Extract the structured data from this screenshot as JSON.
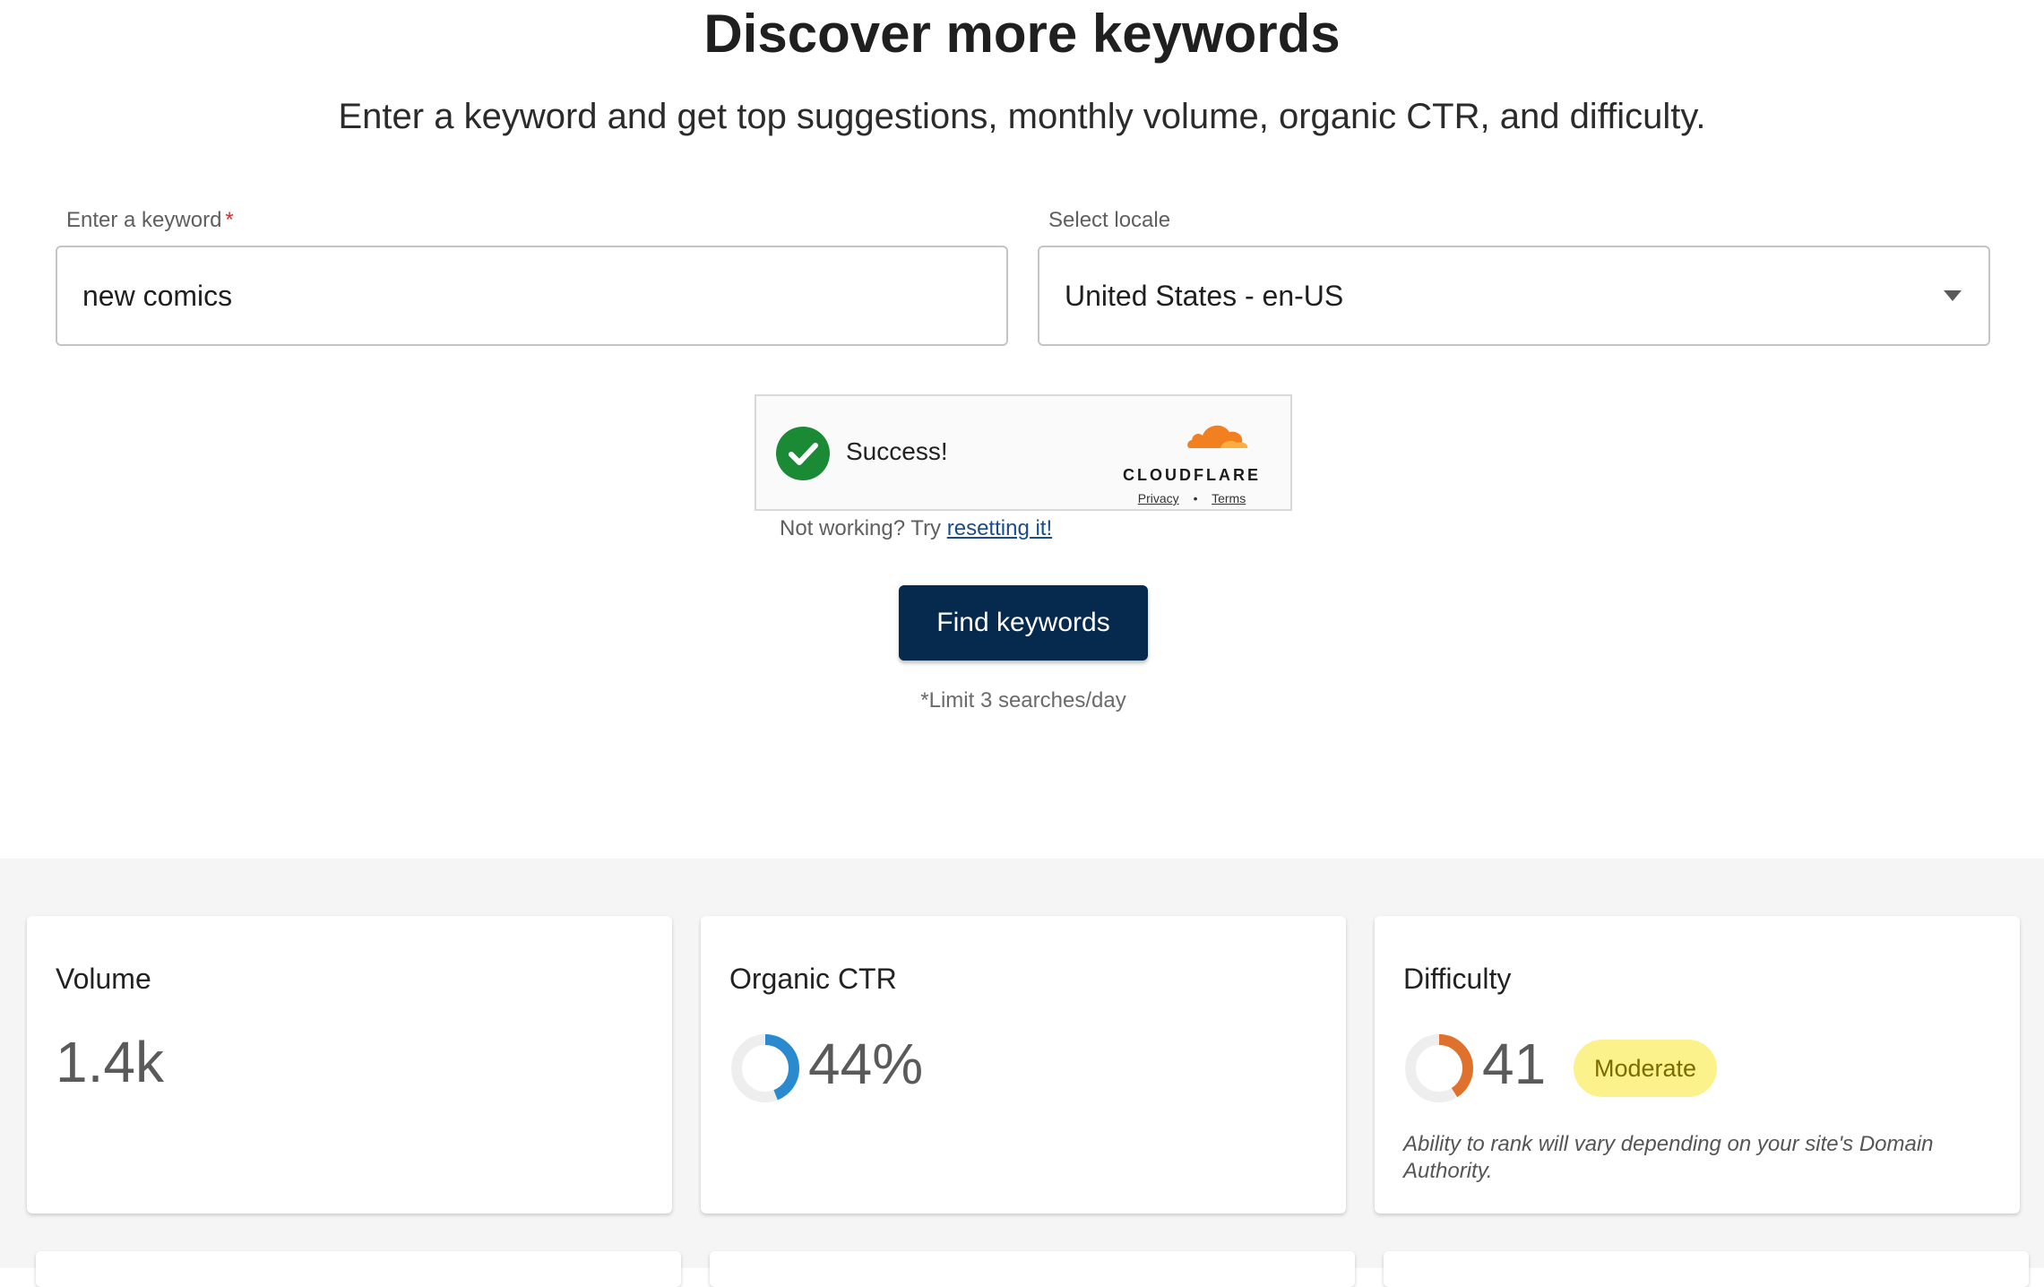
{
  "header": {
    "title": "Discover more keywords",
    "subtitle": "Enter a keyword and get top suggestions, monthly volume, organic CTR, and difficulty."
  },
  "form": {
    "keyword_label": "Enter a keyword",
    "keyword_required_mark": "*",
    "keyword_value": "new comics",
    "locale_label": "Select locale",
    "locale_value": "United States - en-US"
  },
  "captcha": {
    "status": "Success!",
    "brand": "CLOUDFLARE",
    "privacy": "Privacy",
    "separator": "•",
    "terms": "Terms",
    "not_working": "Not working? Try",
    "reset_link": "resetting it!"
  },
  "submit": {
    "label": "Find keywords",
    "limit_note": "*Limit 3 searches/day"
  },
  "metrics": {
    "volume": {
      "title": "Volume",
      "value": "1.4k"
    },
    "ctr": {
      "title": "Organic CTR",
      "value": "44%",
      "fraction": 0.44,
      "color": "#2a8ad0"
    },
    "difficulty": {
      "title": "Difficulty",
      "value": "41",
      "fraction": 0.41,
      "color": "#e0712c",
      "badge": "Moderate",
      "note": "Ability to rank will vary depending on your site's Domain Authority."
    }
  }
}
